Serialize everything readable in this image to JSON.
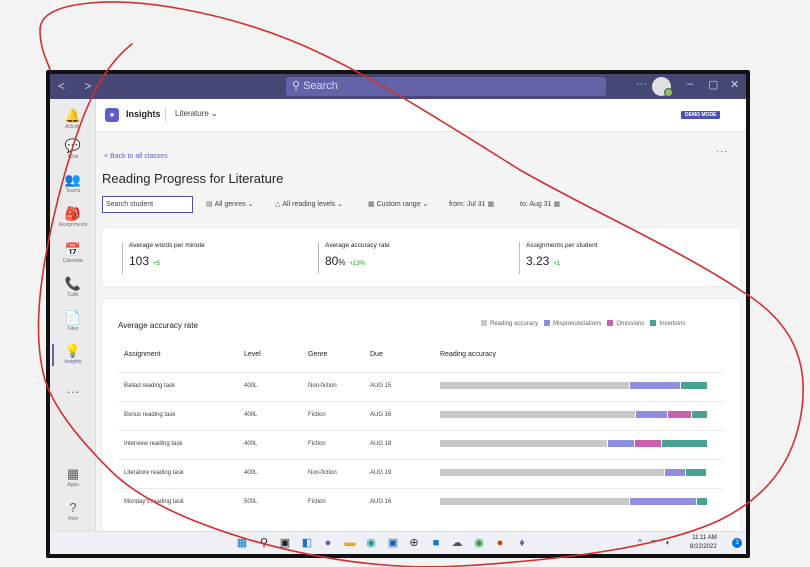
{
  "titlebar": {
    "nav": "< >",
    "search_placeholder": "Search",
    "controls": [
      "···",
      "–",
      "▢",
      "✕"
    ]
  },
  "rail": {
    "items": [
      {
        "icon": "activity-icon",
        "glyph": "🔔",
        "label": "Activity"
      },
      {
        "icon": "chat-icon",
        "glyph": "💬",
        "label": "Chat"
      },
      {
        "icon": "teams-icon",
        "glyph": "👥",
        "label": "Teams"
      },
      {
        "icon": "assignments-icon",
        "glyph": "🎒",
        "label": "Assignments"
      },
      {
        "icon": "calendar-icon",
        "glyph": "📅",
        "label": "Calendar"
      },
      {
        "icon": "calls-icon",
        "glyph": "📞",
        "label": "Calls"
      },
      {
        "icon": "files-icon",
        "glyph": "📄",
        "label": "Files"
      },
      {
        "icon": "insights-icon",
        "glyph": "💡",
        "label": "Insights"
      },
      {
        "icon": "more-apps-icon",
        "glyph": "···",
        "label": ""
      }
    ],
    "bottom": [
      {
        "icon": "apps-icon",
        "glyph": "▦",
        "label": "Apps"
      },
      {
        "icon": "help-icon",
        "glyph": "?",
        "label": "Help"
      }
    ]
  },
  "app": {
    "title": "Insights",
    "class_dropdown": "Literature",
    "demo_badge": "DEMO MODE"
  },
  "page": {
    "back_link": "< Back to all classes",
    "more": "···",
    "title": "Reading Progress for Literature"
  },
  "filters": {
    "search_placeholder": "Search student",
    "genres": "All genres",
    "levels": "All reading levels",
    "range": "Custom range",
    "from": "from: Jul 31",
    "to": "to: Aug 31"
  },
  "metrics": [
    {
      "label": "Average words per minute",
      "value": "103",
      "unit": "",
      "delta": "+5"
    },
    {
      "label": "Average accuracy rate",
      "value": "80",
      "unit": "%",
      "delta": "+13%"
    },
    {
      "label": "Assignments per student",
      "value": "3.23",
      "unit": "",
      "delta": "+1"
    }
  ],
  "accuracy": {
    "title": "Average accuracy rate",
    "legend": [
      {
        "label": "Reading accuracy",
        "color": "#c8c8c8"
      },
      {
        "label": "Mispronunciations",
        "color": "#8f8ddf"
      },
      {
        "label": "Omissions",
        "color": "#c960ad"
      },
      {
        "label": "Insertions",
        "color": "#4aa392"
      }
    ],
    "columns": [
      "Assignment",
      "Level",
      "Genre",
      "Due",
      "Reading accuracy"
    ],
    "rows": [
      {
        "assignment": "Ballad reading task",
        "level": "400L",
        "genre": "Non-fiction",
        "due": "AUG 15",
        "accuracy": 0.71,
        "mispronunciations": 0.19,
        "omissions": 0.0,
        "insertions": 0.1
      },
      {
        "assignment": "Bonus reading task",
        "level": "400L",
        "genre": "Fiction",
        "due": "AUG 16",
        "accuracy": 0.73,
        "mispronunciations": 0.12,
        "omissions": 0.09,
        "insertions": 0.06
      },
      {
        "assignment": "Interview reading task",
        "level": "400L",
        "genre": "Fiction",
        "due": "AUG 18",
        "accuracy": 0.63,
        "mispronunciations": 0.1,
        "omissions": 0.1,
        "insertions": 0.17
      },
      {
        "assignment": "Literature reading task",
        "level": "400L",
        "genre": "Non-fiction",
        "due": "AUG 19",
        "accuracy": 0.84,
        "mispronunciations": 0.08,
        "omissions": 0.0,
        "insertions": 0.08
      },
      {
        "assignment": "Monday's reading task",
        "level": "500L",
        "genre": "Fiction",
        "due": "AUG 16",
        "accuracy": 0.71,
        "mispronunciations": 0.25,
        "omissions": 0.0,
        "insertions": 0.04
      }
    ]
  },
  "taskbar": {
    "icons": [
      "windows-start-icon",
      "search-icon",
      "task-view-icon",
      "widgets-icon",
      "chat-icon",
      "file-explorer-icon",
      "edge-icon",
      "store-icon",
      "dell-icon",
      "app-icon",
      "cloud-icon",
      "chrome-icon",
      "office-icon",
      "teams-icon"
    ],
    "tray": "^ ⌔ ◐",
    "time": "11:11 AM",
    "date": "8/22/2022",
    "notifications": "3"
  },
  "colors": {
    "accent": "#6264a7",
    "annotation": "#d32f2f"
  }
}
